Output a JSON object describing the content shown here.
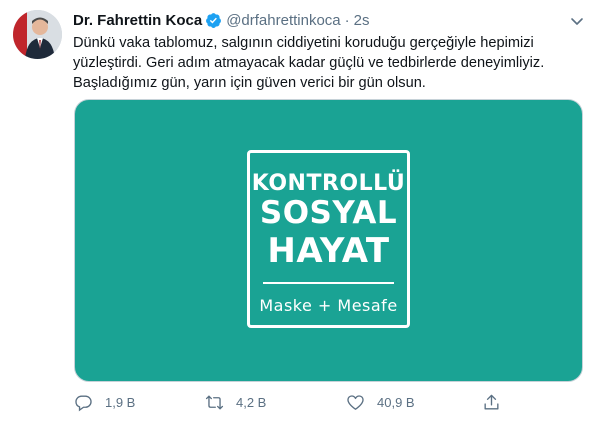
{
  "author": {
    "name": "Dr. Fahrettin Koca",
    "handle": "@drfahrettinkoca",
    "separator": "·",
    "time": "2s"
  },
  "tweet": {
    "lines": [
      "Dünkü vaka tablomuz, salgının ciddiyetini koruduğu gerçeğiyle hepimizi",
      "yüzleştirdi. Geri adım atmayacak kadar güçlü ve tedbirlerde deneyimliyiz.",
      "Başladığımız gün, yarın için güven verici bir gün olsun."
    ]
  },
  "media": {
    "background": "#1aa394",
    "logo": {
      "line1": "KONTROLLÜ",
      "line2": "SOSYAL",
      "line3": "HAYAT",
      "line4": "Maske + Mesafe"
    }
  },
  "actions": {
    "reply_count": "1,9 B",
    "retweet_count": "4,2 B",
    "like_count": "40,9 B"
  },
  "icons": {
    "verified": "verified-badge-icon",
    "more": "chevron-down-icon",
    "reply": "reply-icon",
    "retweet": "retweet-icon",
    "like": "heart-icon",
    "share": "share-icon"
  },
  "colors": {
    "accent": "#1da1f2",
    "secondary_text": "#5b7083",
    "media_teal": "#1aa394"
  }
}
